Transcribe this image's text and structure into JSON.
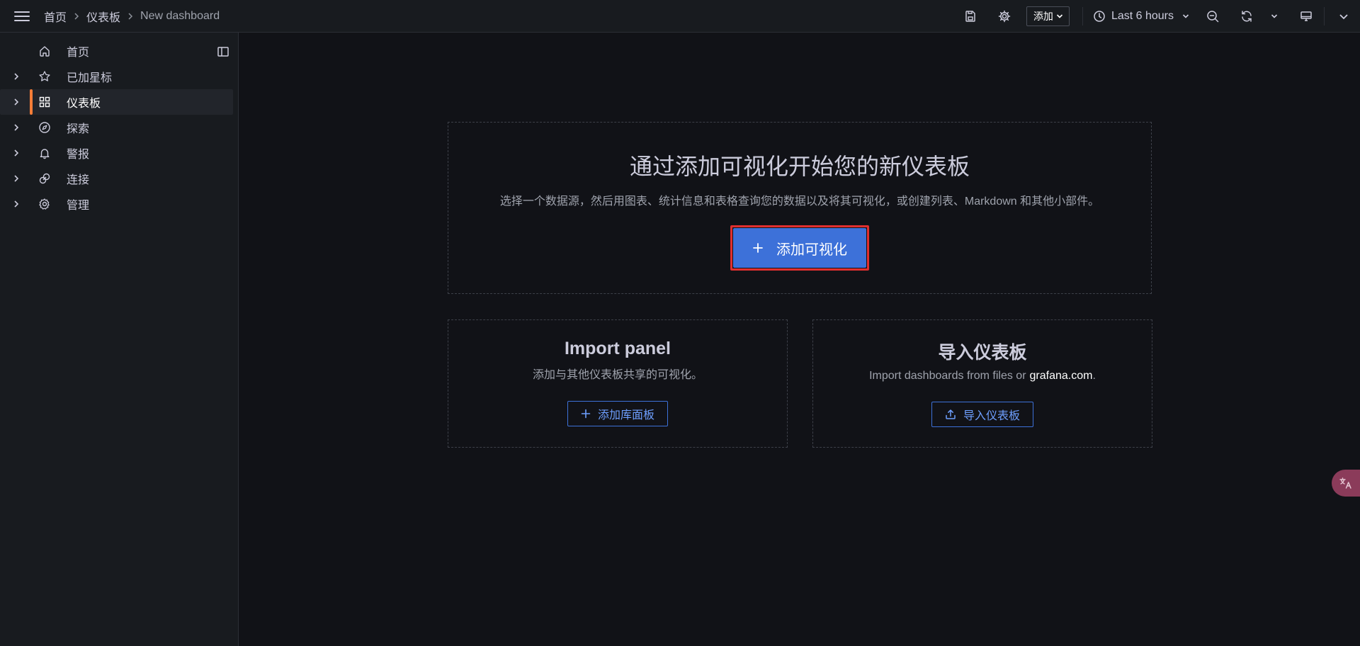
{
  "header": {
    "breadcrumbs": [
      "首页",
      "仪表板",
      "New dashboard"
    ],
    "add_label": "添加",
    "time_range": "Last 6 hours"
  },
  "sidebar": {
    "items": [
      {
        "label": "首页",
        "icon": "home-icon",
        "expandable": false,
        "active": false
      },
      {
        "label": "已加星标",
        "icon": "star-icon",
        "expandable": true,
        "active": false
      },
      {
        "label": "仪表板",
        "icon": "apps-icon",
        "expandable": true,
        "active": true
      },
      {
        "label": "探索",
        "icon": "compass-icon",
        "expandable": true,
        "active": false
      },
      {
        "label": "警报",
        "icon": "bell-icon",
        "expandable": true,
        "active": false
      },
      {
        "label": "连接",
        "icon": "link-icon",
        "expandable": true,
        "active": false
      },
      {
        "label": "管理",
        "icon": "cog-icon",
        "expandable": true,
        "active": false
      }
    ]
  },
  "main": {
    "hero": {
      "title": "通过添加可视化开始您的新仪表板",
      "description": "选择一个数据源，然后用图表、统计信息和表格查询您的数据以及将其可视化，或创建列表、Markdown 和其他小部件。",
      "button_label": "添加可视化"
    },
    "import_panel": {
      "title": "Import panel",
      "description": "添加与其他仪表板共享的可视化。",
      "button_label": "添加库面板"
    },
    "import_dashboard": {
      "title": "导入仪表板",
      "description_prefix": "Import dashboards from files or",
      "description_link": "grafana.com",
      "description_suffix": ".",
      "button_label": "导入仪表板"
    }
  },
  "colors": {
    "background": "#111217",
    "panel": "#181b1f",
    "primary": "#3d71d9",
    "active_accent": "#f57d37",
    "highlight_border": "#e02f2f"
  }
}
